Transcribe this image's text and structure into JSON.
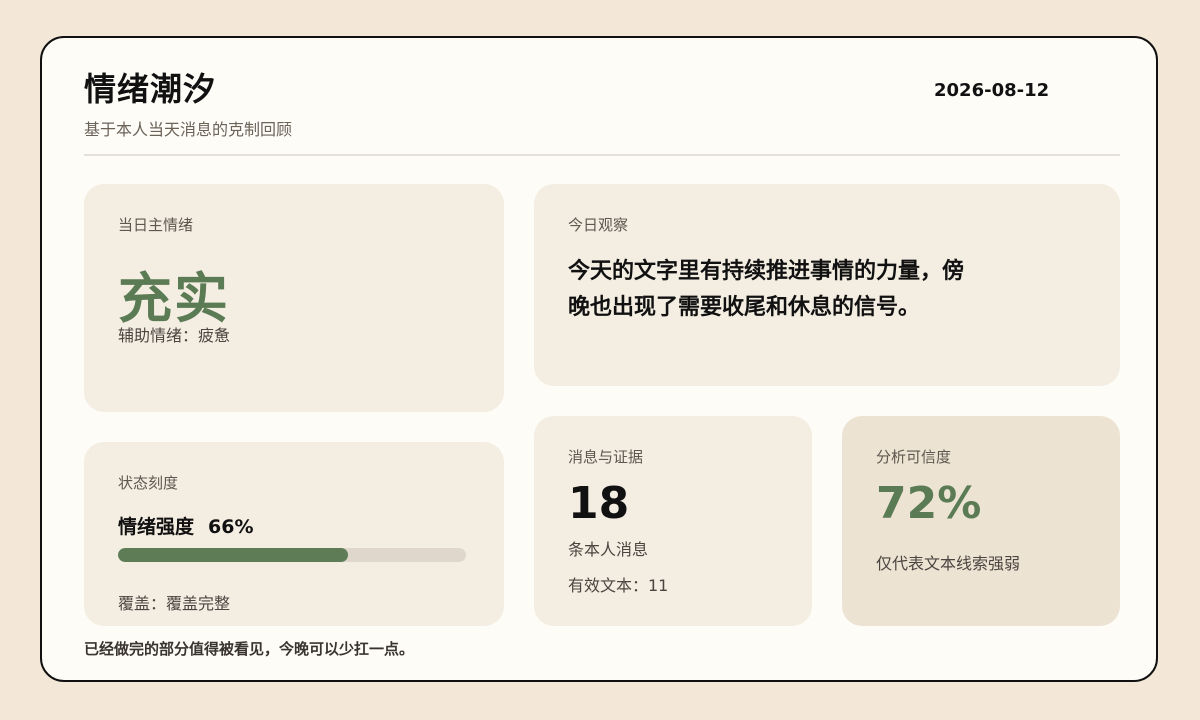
{
  "header": {
    "title": "情绪潮汐",
    "subtitle": "基于本人当天消息的克制回顾",
    "date": "2026-08-12"
  },
  "mood": {
    "label": "当日主情绪",
    "primary": "充实",
    "secondary": "辅助情绪：疲惫"
  },
  "observation": {
    "label": "今日观察",
    "text": "今天的文字里有持续推进事情的力量，傍晚也出现了需要收尾和休息的信号。"
  },
  "state": {
    "label": "状态刻度",
    "intensity_label": "情绪强度",
    "intensity_text": "66%",
    "intensity_value": 0.66,
    "coverage": "覆盖：覆盖完整"
  },
  "messages": {
    "label": "消息与证据",
    "count": "18",
    "unit": "条本人消息",
    "valid_text": "有效文本：11"
  },
  "confidence": {
    "label": "分析可信度",
    "value": "72%",
    "note": "仅代表文本线索强弱"
  },
  "footer": {
    "text": "已经做完的部分值得被看见，今晚可以少扛一点。"
  },
  "colors": {
    "accent": "#5b7b55",
    "background": "#f3e8d8",
    "panel": "#fdfcf7",
    "card": "#f3ede2",
    "card_highlight": "#ede3d3"
  }
}
